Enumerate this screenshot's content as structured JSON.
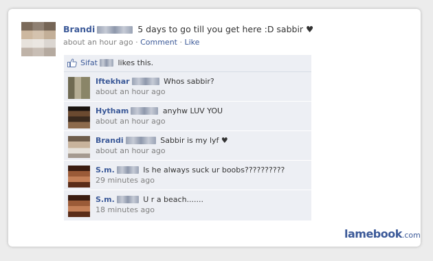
{
  "post": {
    "author": "Brandi",
    "message": "5 days to go till you get here :D sabbir ♥",
    "time": "about an hour ago",
    "comment_label": "Comment",
    "like_label": "Like",
    "separator": "·"
  },
  "likes": {
    "name": "Sifat",
    "suffix": "likes this."
  },
  "comments": [
    {
      "author": "Iftekhar",
      "text": "Whos sabbir?",
      "time": "about an hour ago"
    },
    {
      "author": "Hytham",
      "text": "anyhw LUV YOU",
      "time": "about an hour ago"
    },
    {
      "author": "Brandi",
      "text": "Sabbir is my lyf ♥",
      "time": "about an hour ago"
    },
    {
      "author": "S.m.",
      "text": "Is he always suck ur boobs??????????",
      "time": "29 minutes ago"
    },
    {
      "author": "S.m.",
      "text": "U r a beach.......",
      "time": "18 minutes ago"
    }
  ],
  "watermark": {
    "name": "lamebook",
    "domain": ".com"
  },
  "colors": {
    "link": "#3b5998",
    "comment_bg": "#edeff4",
    "meta": "#808080"
  }
}
